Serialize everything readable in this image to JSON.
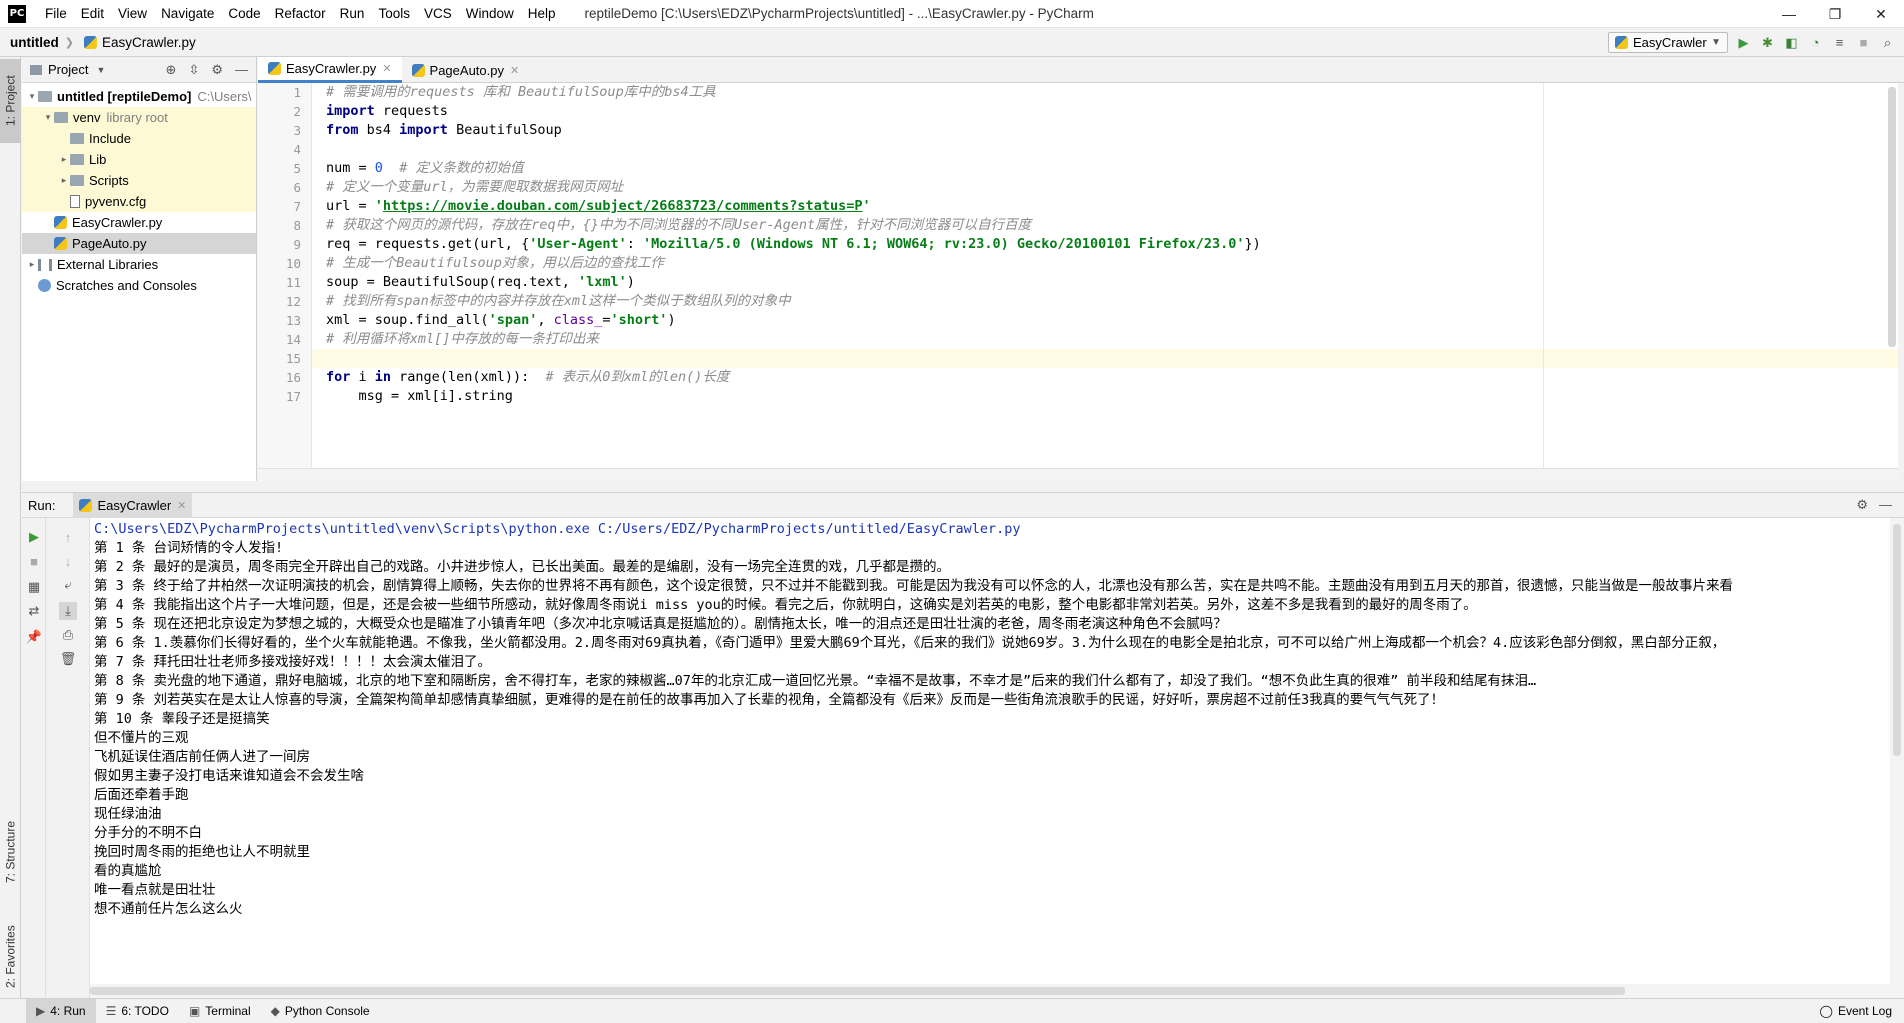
{
  "app": {
    "logo": "PC",
    "window_title": "reptileDemo [C:\\Users\\EDZ\\PycharmProjects\\untitled] - ...\\EasyCrawler.py - PyCharm",
    "menu": [
      "File",
      "Edit",
      "View",
      "Navigate",
      "Code",
      "Refactor",
      "Run",
      "Tools",
      "VCS",
      "Window",
      "Help"
    ],
    "controls": {
      "minimize": "—",
      "maximize": "❐",
      "close": "✕"
    }
  },
  "navbar": {
    "project": "untitled",
    "file": "EasyCrawler.py",
    "run_config": "EasyCrawler"
  },
  "left_stripe": {
    "project_tab": "1: Project",
    "structure_tab": "7: Structure",
    "favorites_tab": "2: Favorites"
  },
  "project_panel": {
    "title": "Project",
    "tree": [
      {
        "label": "untitled [reptileDemo]",
        "suffix": "C:\\Users\\",
        "indent": 0,
        "arrow": "▾",
        "icon": "folder"
      },
      {
        "label": "venv",
        "suffix": "library root",
        "indent": 1,
        "arrow": "▾",
        "icon": "folder"
      },
      {
        "label": "Include",
        "suffix": "",
        "indent": 2,
        "arrow": "",
        "icon": "folder"
      },
      {
        "label": "Lib",
        "suffix": "",
        "indent": 2,
        "arrow": "▸",
        "icon": "folder"
      },
      {
        "label": "Scripts",
        "suffix": "",
        "indent": 2,
        "arrow": "▸",
        "icon": "folder"
      },
      {
        "label": "pyvenv.cfg",
        "suffix": "",
        "indent": 2,
        "arrow": "",
        "icon": "file"
      },
      {
        "label": "EasyCrawler.py",
        "suffix": "",
        "indent": 1,
        "arrow": "",
        "icon": "py"
      },
      {
        "label": "PageAuto.py",
        "suffix": "",
        "indent": 1,
        "arrow": "",
        "icon": "py"
      },
      {
        "label": "External Libraries",
        "suffix": "",
        "indent": 0,
        "arrow": "▸",
        "icon": "lib"
      },
      {
        "label": "Scratches and Consoles",
        "suffix": "",
        "indent": 0,
        "arrow": "",
        "icon": "scratch"
      }
    ]
  },
  "editor": {
    "tabs": [
      {
        "label": "EasyCrawler.py",
        "active": true
      },
      {
        "label": "PageAuto.py",
        "active": false
      }
    ],
    "line_numbers": [
      "1",
      "2",
      "3",
      "4",
      "5",
      "6",
      "7",
      "8",
      "9",
      "10",
      "11",
      "12",
      "13",
      "14",
      "15",
      "16",
      "17"
    ],
    "current_line": 15,
    "lines": [
      [
        {
          "t": "# 需要调用的requests 库和 BeautifulSoup库中的bs4工具",
          "c": "cmt"
        }
      ],
      [
        {
          "t": "import",
          "c": "kw"
        },
        {
          "t": " requests",
          "c": ""
        }
      ],
      [
        {
          "t": "from",
          "c": "kw"
        },
        {
          "t": " bs4 ",
          "c": ""
        },
        {
          "t": "import",
          "c": "kw"
        },
        {
          "t": " BeautifulSoup",
          "c": ""
        }
      ],
      [],
      [
        {
          "t": "num = ",
          "c": ""
        },
        {
          "t": "0",
          "c": "num"
        },
        {
          "t": "  ",
          "c": ""
        },
        {
          "t": "# 定义条数的初始值",
          "c": "cmt"
        }
      ],
      [
        {
          "t": "# 定义一个变量url，为需要爬取数据我网页网址",
          "c": "cmt"
        }
      ],
      [
        {
          "t": "url = ",
          "c": ""
        },
        {
          "t": "'",
          "c": "str"
        },
        {
          "t": "https://movie.douban.com/subject/26683723/comments?status=P",
          "c": "url"
        },
        {
          "t": "'",
          "c": "str"
        }
      ],
      [
        {
          "t": "# 获取这个网页的源代码，存放在req中，{}中为不同浏览器的不同User-Agent属性，针对不同浏览器可以自行百度",
          "c": "cmt"
        }
      ],
      [
        {
          "t": "req = requests.get(url, {",
          "c": ""
        },
        {
          "t": "'User-Agent'",
          "c": "str"
        },
        {
          "t": ": ",
          "c": ""
        },
        {
          "t": "'Mozilla/5.0 (Windows NT 6.1; WOW64; rv:23.0) Gecko/20100101 Firefox/23.0'",
          "c": "str"
        },
        {
          "t": "})",
          "c": ""
        }
      ],
      [
        {
          "t": "# 生成一个Beautifulsoup对象，用以后边的查找工作",
          "c": "cmt"
        }
      ],
      [
        {
          "t": "soup = BeautifulSoup(req.text, ",
          "c": ""
        },
        {
          "t": "'lxml'",
          "c": "str"
        },
        {
          "t": ")",
          "c": ""
        }
      ],
      [
        {
          "t": "# 找到所有span标签中的内容并存放在xml这样一个类似于数组队列的对象中",
          "c": "cmt"
        }
      ],
      [
        {
          "t": "xml = soup.find_all(",
          "c": ""
        },
        {
          "t": "'span'",
          "c": "str"
        },
        {
          "t": ", ",
          "c": ""
        },
        {
          "t": "class_",
          "c": "param"
        },
        {
          "t": "=",
          "c": ""
        },
        {
          "t": "'short'",
          "c": "str"
        },
        {
          "t": ")",
          "c": ""
        }
      ],
      [
        {
          "t": "# 利用循环将xml[]中存放的每一条打印出来",
          "c": "cmt"
        }
      ],
      [],
      [
        {
          "t": "for",
          "c": "kw"
        },
        {
          "t": " i ",
          "c": ""
        },
        {
          "t": "in",
          "c": "kw"
        },
        {
          "t": " range(len(xml)):  ",
          "c": ""
        },
        {
          "t": "# 表示从0到xml的len()长度",
          "c": "cmt"
        }
      ],
      [
        {
          "t": "    msg = xml[i].string",
          "c": ""
        }
      ]
    ]
  },
  "run_panel": {
    "label": "Run:",
    "tab": "EasyCrawler",
    "console": [
      {
        "t": "C:\\Users\\EDZ\\PycharmProjects\\untitled\\venv\\Scripts\\python.exe C:/Users/EDZ/PycharmProjects/untitled/EasyCrawler.py",
        "c": "con-cmd"
      },
      {
        "t": "第 1 条 台词矫情的令人发指!",
        "c": ""
      },
      {
        "t": "第 2 条 最好的是演员，周冬雨完全开辟出自己的戏路。小井进步惊人，已长出美面。最差的是编剧，没有一场完全连贯的戏，几乎都是攒的。",
        "c": ""
      },
      {
        "t": "第 3 条 终于给了井柏然一次证明演技的机会，剧情算得上顺畅，失去你的世界将不再有颜色，这个设定很赞，只不过并不能戳到我。可能是因为我没有可以怀念的人，北漂也没有那么苦，实在是共鸣不能。主题曲没有用到五月天的那首，很遗憾，只能当做是一般故事片来看",
        "c": ""
      },
      {
        "t": "第 4 条 我能指出这个片子一大堆问题，但是，还是会被一些细节所感动，就好像周冬雨说i miss you的时候。看完之后，你就明白，这确实是刘若英的电影，整个电影都非常刘若英。另外，这差不多是我看到的最好的周冬雨了。",
        "c": ""
      },
      {
        "t": "第 5 条 现在还把北京设定为梦想之城的，大概受众也是瞄准了小镇青年吧（多次冲北京喊话真是挺尴尬的）。剧情拖太长，唯一的泪点还是田壮壮演的老爸，周冬雨老演这种角色不会腻吗？",
        "c": ""
      },
      {
        "t": "第 6 条 1.羡慕你们长得好看的，坐个火车就能艳遇。不像我，坐火箭都没用。2.周冬雨对69真执着，《奇门遁甲》里爱大鹏69个耳光，《后来的我们》说她69岁。3.为什么现在的电影全是拍北京，可不可以给广州上海成都一个机会？4.应该彩色部分倒叙，黑白部分正叙，",
        "c": ""
      },
      {
        "t": "第 7 条 拜托田壮壮老师多接戏接好戏！！！！太会演太催泪了。",
        "c": ""
      },
      {
        "t": "第 8 条 卖光盘的地下通道，鼎好电脑城，北京的地下室和隔断房，舍不得打车，老家的辣椒酱…07年的北京汇成一道回忆光景。“幸福不是故事，不幸才是”后来的我们什么都有了，却没了我们。“想不负此生真的很难” 前半段和结尾有抹泪…",
        "c": ""
      },
      {
        "t": "第 9 条 刘若英实在是太让人惊喜的导演，全篇架构简单却感情真挚细腻，更难得的是在前任的故事再加入了长辈的视角，全篇都没有《后来》反而是一些街角流浪歌手的民谣，好好听，票房超不过前任3我真的要气气气死了！",
        "c": ""
      },
      {
        "t": "第 10 条 睾段子还是挺搞笑",
        "c": ""
      },
      {
        "t": "但不懂片的三观",
        "c": ""
      },
      {
        "t": "飞机延误住酒店前任俩人进了一间房",
        "c": ""
      },
      {
        "t": "假如男主妻子没打电话来谁知道会不会发生啥",
        "c": ""
      },
      {
        "t": "后面还牵着手跑",
        "c": ""
      },
      {
        "t": "现任绿油油",
        "c": ""
      },
      {
        "t": "分手分的不明不白",
        "c": ""
      },
      {
        "t": "挽回时周冬雨的拒绝也让人不明就里",
        "c": ""
      },
      {
        "t": "看的真尴尬",
        "c": ""
      },
      {
        "t": "唯一看点就是田壮壮",
        "c": ""
      },
      {
        "t": "想不通前任片怎么这么火",
        "c": ""
      }
    ]
  },
  "statusbar": {
    "tabs": [
      {
        "label": "4: Run",
        "icon": "▶",
        "active": true
      },
      {
        "label": "6: TODO",
        "icon": "☰",
        "active": false
      },
      {
        "label": "Terminal",
        "icon": "▣",
        "active": false
      },
      {
        "label": "Python Console",
        "icon": "◆",
        "active": false
      }
    ],
    "event_log": "Event Log"
  }
}
